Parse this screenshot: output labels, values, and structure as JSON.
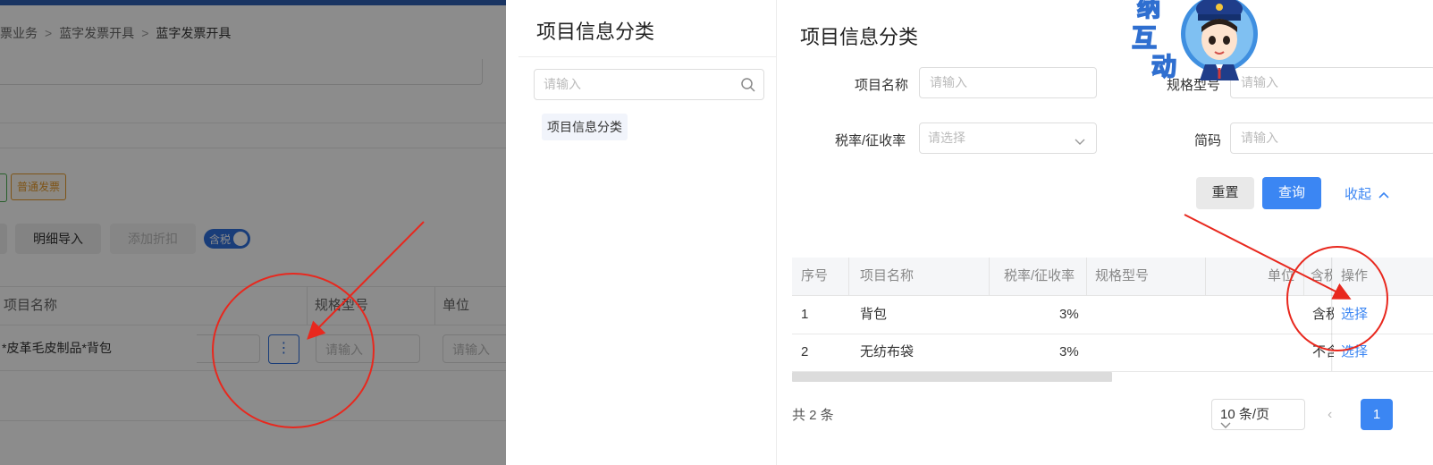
{
  "background": {
    "breadcrumb": [
      "票业务",
      "蓝字发票开具",
      "蓝字发票开具"
    ],
    "tags": {
      "normal_invoice": "普通发票"
    },
    "toolbar": {
      "detail_import": "明细导入",
      "add_discount": "添加折扣",
      "tax_toggle": "含税"
    },
    "table": {
      "headers": [
        "项目名称",
        "规格型号",
        "单位"
      ],
      "row": {
        "item_name": "*皮革毛皮制品*背包",
        "spec_placeholder": "请输入",
        "unit_placeholder": "请输入"
      }
    }
  },
  "category_panel": {
    "title": "项目信息分类",
    "search_placeholder": "请输入",
    "tree_node": "项目信息分类"
  },
  "main_panel": {
    "title": "项目信息分类",
    "filters": {
      "item_name_label": "项目名称",
      "item_name_placeholder": "请输入",
      "spec_label": "规格型号",
      "spec_placeholder": "请输入",
      "tax_rate_label": "税率/征收率",
      "tax_rate_placeholder": "请选择",
      "code_label": "简码",
      "code_placeholder": "请输入"
    },
    "buttons": {
      "reset": "重置",
      "query": "查询",
      "collapse": "收起"
    },
    "table": {
      "headers": [
        "序号",
        "项目名称",
        "税率/征收率",
        "规格型号",
        "单位",
        "含税",
        "操作"
      ],
      "rows": [
        {
          "index": "1",
          "name": "背包",
          "tax_rate": "3%",
          "spec": "",
          "unit": "",
          "tax_incl": "含税",
          "op": "选择"
        },
        {
          "index": "2",
          "name": "无纺布袋",
          "tax_rate": "3%",
          "spec": "",
          "unit": "",
          "tax_incl": "不含税",
          "op": "选择"
        }
      ]
    },
    "pagination": {
      "total": "共 2 条",
      "page_size": "10 条/页",
      "current_page": "1"
    }
  },
  "mascot": {
    "text": [
      "纳",
      "互",
      "动"
    ]
  },
  "colors": {
    "primary": "#3b86f3",
    "annotation": "#e8281e",
    "top_bar": "#2f5fb3"
  }
}
